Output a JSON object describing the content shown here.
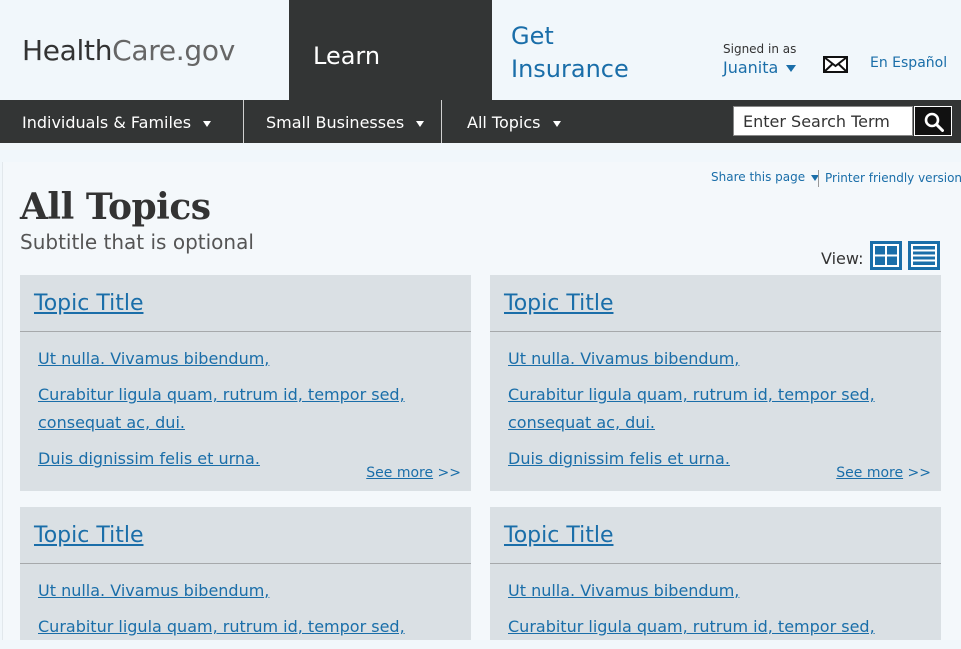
{
  "header": {
    "logo_health": "Health",
    "logo_care": "Care.gov",
    "learn_tab": "Learn",
    "get_insurance": "Get Insurance",
    "signed_in_label": "Signed in as",
    "signed_in_user": "Juanita",
    "espanol": "En Español"
  },
  "nav": {
    "items": [
      {
        "label": "Individuals & Familes"
      },
      {
        "label": "Small Businesses"
      },
      {
        "label": "All Topics"
      }
    ],
    "search_placeholder": "Enter Search Term"
  },
  "page": {
    "share": "Share this page",
    "printer": "Printer friendly version",
    "title": "All Topics",
    "subtitle": "Subtitle that is optional",
    "view_label": "View:"
  },
  "cards": [
    {
      "title": "Topic Title",
      "links": [
        "Ut nulla. Vivamus bibendum,",
        "Curabitur ligula quam, rutrum id, tempor sed, consequat ac, dui.",
        "Duis dignissim felis et urna."
      ],
      "see_more": "See more",
      "see_more_arrows": ">>"
    },
    {
      "title": "Topic Title",
      "links": [
        "Ut nulla. Vivamus bibendum,",
        "Curabitur ligula quam, rutrum id, tempor sed, consequat ac, dui.",
        "Duis dignissim felis et urna."
      ],
      "see_more": "See more",
      "see_more_arrows": ">>"
    },
    {
      "title": "Topic Title",
      "links": [
        "Ut nulla. Vivamus bibendum,",
        "Curabitur ligula quam, rutrum id, tempor sed,"
      ]
    },
    {
      "title": "Topic Title",
      "links": [
        "Ut nulla. Vivamus bibendum,",
        "Curabitur ligula quam, rutrum id, tempor sed,"
      ]
    }
  ],
  "icons": {
    "mail": "envelope-icon",
    "search": "magnifier-icon",
    "grid_view": "grid-view-icon",
    "list_view": "list-view-icon"
  },
  "colors": {
    "link_blue": "#1a6ea9",
    "dark_bar": "#333535",
    "card_bg": "#dae0e4",
    "page_bg": "#f1f7fb"
  }
}
